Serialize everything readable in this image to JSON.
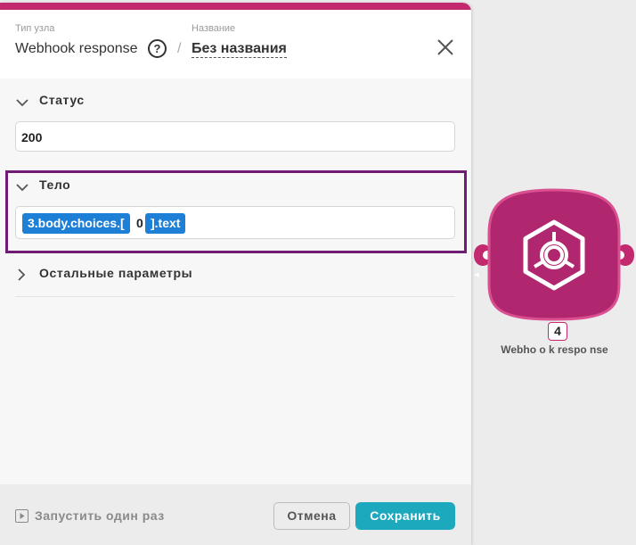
{
  "header": {
    "type_label": "Тип узла",
    "type_value": "Webhook response",
    "help_glyph": "?",
    "name_label": "Название",
    "name_value": "Без названия"
  },
  "sections": {
    "status": {
      "title": "Статус",
      "value": "200"
    },
    "body": {
      "title": "Тело",
      "tokens": [
        "3.body.choices.[",
        "0",
        "].text"
      ]
    },
    "other": {
      "title": "Остальные параметры"
    }
  },
  "footer": {
    "run_label": "Запустить один раз",
    "cancel_label": "Отмена",
    "save_label": "Сохранить"
  },
  "node": {
    "number": "4",
    "label": "Webho o k respo nse"
  },
  "colors": {
    "accent": "#c2296e",
    "highlight": "#701c74",
    "pill": "#1e7fd6",
    "save": "#1ca8bd"
  }
}
